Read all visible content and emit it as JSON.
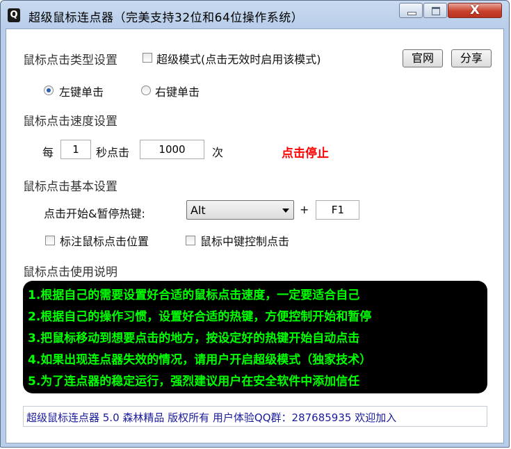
{
  "window": {
    "icon_char": "Q",
    "title": "超级鼠标连点器（完美支持32位和64位操作系统）",
    "close_label": "X"
  },
  "click_type": {
    "section_label": "鼠标点击类型设置",
    "super_mode_label": "超级模式(点击无效时启用该模式)",
    "super_mode_checked": false,
    "official_site_label": "官网",
    "share_label": "分享",
    "left_click_label": "左键单击",
    "right_click_label": "右键单击",
    "selected": "left"
  },
  "speed": {
    "section_label": "鼠标点击速度设置",
    "per_label": "每",
    "seconds_value": "1",
    "seconds_label": "秒点击",
    "clicks_value": "1000",
    "times_label": "次",
    "stop_label": "点击停止"
  },
  "basic": {
    "section_label": "鼠标点击基本设置",
    "hotkey_label": "点击开始&暂停热键:",
    "hotkey_modifier": "Alt",
    "plus": "+",
    "hotkey_key": "F1",
    "mark_position_label": "标注鼠标点击位置",
    "mark_position_checked": false,
    "middle_button_label": "鼠标中键控制点击",
    "middle_button_checked": false
  },
  "instructions": {
    "section_label": "鼠标点击使用说明",
    "lines": [
      "1.根据自己的需要设置好合适的鼠标点击速度，一定要适合自己",
      "2.根据自己的操作习惯，设置好合适的热键，方便控制开始和暂停",
      "3.把鼠标移动到想要点击的地方，按设定好的热键开始自动点击",
      "4.如果出现连点器失效的情况，请用户开启超级模式（独家技术）",
      "5.为了连点器的稳定运行，强烈建议用户在安全软件中添加信任"
    ]
  },
  "status": {
    "text": "超级鼠标连点器 5.0 森林精品 版权所有 用户体验QQ群：287685935 欢迎加入"
  }
}
